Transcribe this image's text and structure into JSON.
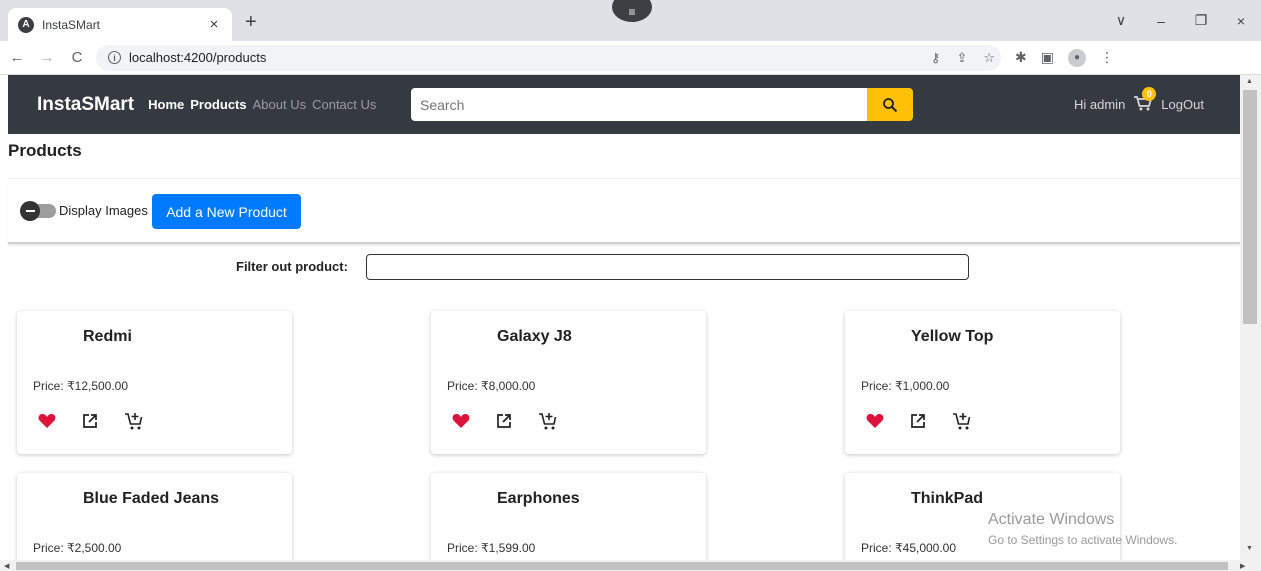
{
  "browser": {
    "tab_title": "InstaSMart",
    "tab_close": "×",
    "new_tab": "+",
    "url": "localhost:4200/products",
    "window_controls": [
      "∨",
      "–",
      "❐",
      "×"
    ]
  },
  "navbar": {
    "brand": "InstaSMart",
    "links": [
      "Home",
      "Products",
      "About Us",
      "Contact Us"
    ],
    "search_placeholder": "Search",
    "greeting": "Hi admin",
    "cart_count": "0",
    "logout": "LogOut",
    "accent_color": "#ffc107"
  },
  "page": {
    "title": "Products",
    "toggle_label": "Display Images",
    "add_button": "Add a New Product",
    "filter_label": "Filter out product:"
  },
  "products": [
    {
      "name": "Redmi",
      "price": "Price: ₹12,500.00"
    },
    {
      "name": "Galaxy J8",
      "price": "Price: ₹8,000.00"
    },
    {
      "name": "Yellow Top",
      "price": "Price: ₹1,000.00"
    },
    {
      "name": "Blue Faded Jeans",
      "price": "Price: ₹2,500.00"
    },
    {
      "name": "Earphones",
      "price": "Price: ₹1,599.00"
    },
    {
      "name": "ThinkPad",
      "price": "Price: ₹45,000.00"
    }
  ],
  "watermark": {
    "line1": "Activate Windows",
    "line2": "Go to Settings to activate Windows."
  },
  "icons": {
    "favorite": "heart-icon",
    "details": "open-external-icon",
    "cart": "add-to-cart-icon",
    "favorite_color": "#dc143c"
  }
}
